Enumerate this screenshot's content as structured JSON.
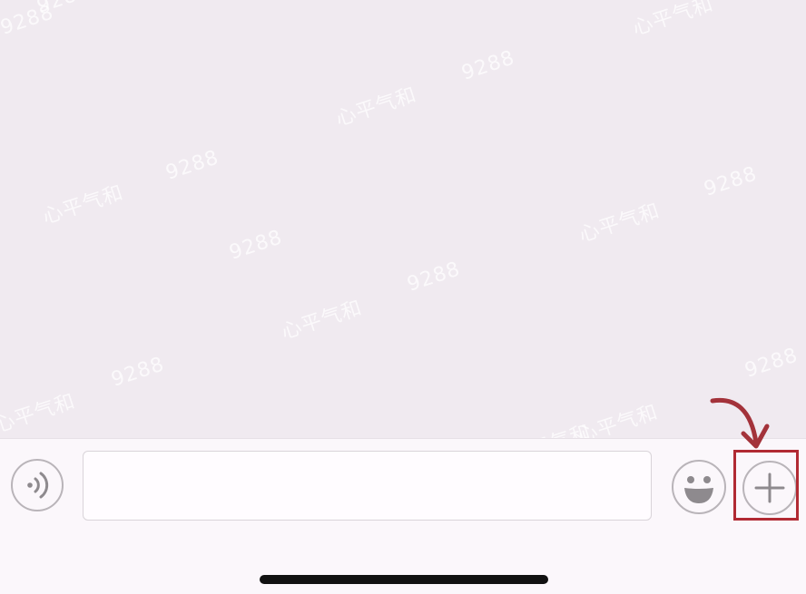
{
  "watermarks": [
    {
      "text": "9288"
    },
    {
      "text": "心平气和"
    },
    {
      "text": "9288"
    },
    {
      "text": "心平气和"
    },
    {
      "text": "9288"
    },
    {
      "text": "心平气和"
    },
    {
      "text": "9288"
    },
    {
      "text": "心平气和"
    },
    {
      "text": "9288"
    },
    {
      "text": "心平气和"
    },
    {
      "text": "9288"
    },
    {
      "text": "心平气和"
    },
    {
      "text": "9288"
    },
    {
      "text": "心平气和"
    },
    {
      "text": "9288"
    },
    {
      "text": "心平气和"
    },
    {
      "text": "9288"
    }
  ],
  "input_bar": {
    "voice_icon": "voice-wave-icon",
    "message_value": "",
    "message_placeholder": "",
    "emoji_icon": "smiley-icon",
    "add_icon": "plus-icon"
  },
  "annotation": {
    "arrow_color": "#a3323a",
    "box_color": "#b12a33"
  },
  "colors": {
    "chat_background": "#f0eaf0",
    "input_bar_background": "#fbf7fb",
    "icon_gray": "#8e8a8e"
  }
}
